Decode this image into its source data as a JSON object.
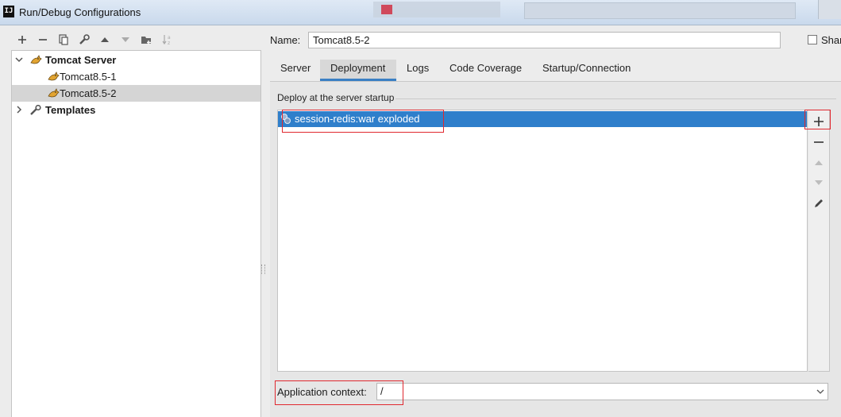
{
  "window": {
    "title": "Run/Debug Configurations",
    "logo_text": "IJ"
  },
  "toolbar": {
    "icons": [
      "plus-icon",
      "minus-icon",
      "copy-icon",
      "wrench-icon",
      "arrow-up-icon",
      "arrow-down-icon",
      "folder-add-icon",
      "sort-alpha-icon"
    ]
  },
  "tree": {
    "group": "Tomcat Server",
    "items": [
      "Tomcat8.5-1",
      "Tomcat8.5-2"
    ],
    "selected": "Tomcat8.5-2",
    "templates": "Templates"
  },
  "form": {
    "name_label": "Name:",
    "name_value": "Tomcat8.5-2",
    "share_label": "Shar"
  },
  "tabs": [
    {
      "label": "Server"
    },
    {
      "label": "Deployment"
    },
    {
      "label": "Logs"
    },
    {
      "label": "Code Coverage"
    },
    {
      "label": "Startup/Connection"
    }
  ],
  "active_tab": "Deployment",
  "deployment": {
    "section_title": "Deploy at the server startup",
    "artifacts": [
      "session-redis:war exploded"
    ],
    "side_buttons": [
      "add",
      "remove",
      "move-up",
      "move-down",
      "edit"
    ]
  },
  "context": {
    "label": "Application context:",
    "value": "/"
  },
  "colors": {
    "selection": "#2f7fcb",
    "annotation": "#e0282f",
    "tab_underline": "#3a7fc4"
  }
}
